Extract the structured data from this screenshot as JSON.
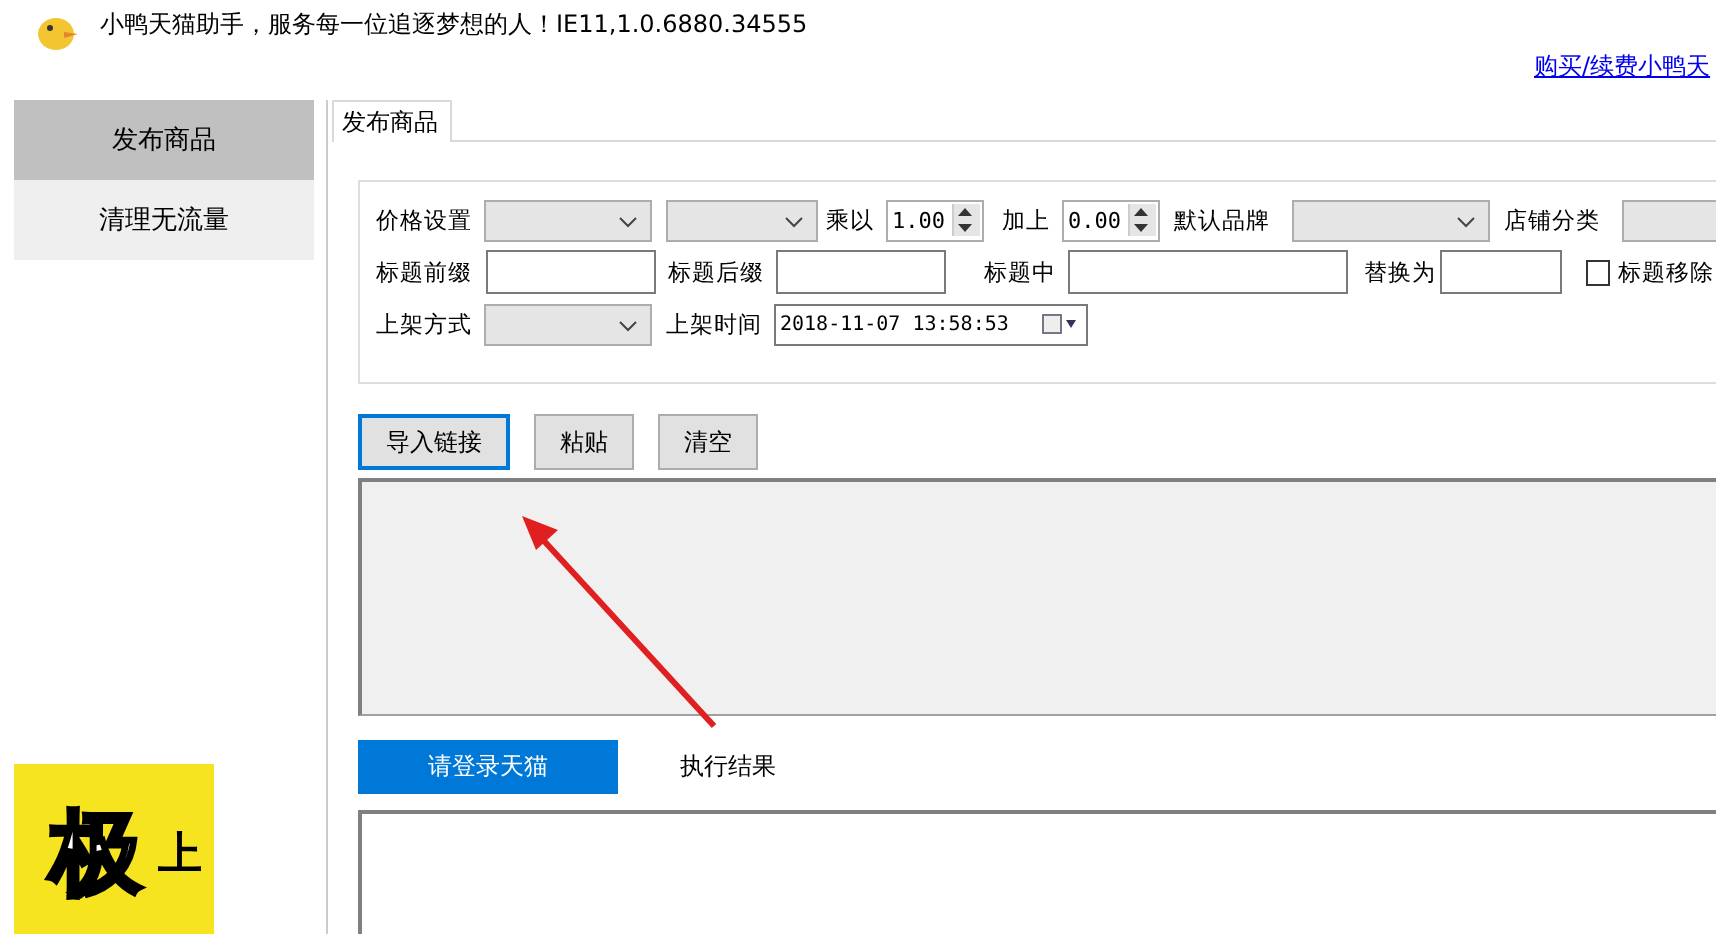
{
  "window": {
    "title": "小鸭天猫助手，服务每一位追逐梦想的人！IE11,1.0.6880.34555",
    "link": "购买/续费小鸭天"
  },
  "sidebar": {
    "items": [
      {
        "label": "发布商品",
        "selected": true
      },
      {
        "label": "清理无流量",
        "selected": false
      }
    ]
  },
  "tabs": [
    {
      "label": "发布商品",
      "selected": true
    }
  ],
  "form": {
    "lines": [
      {
        "fields": [
          {
            "kind": "label",
            "text": "价格设置"
          },
          {
            "kind": "select"
          },
          {
            "kind": "select"
          },
          {
            "kind": "label",
            "text": "乘以"
          },
          {
            "kind": "spin",
            "value": "1.00"
          },
          {
            "kind": "label",
            "text": "加上"
          },
          {
            "kind": "spin",
            "value": "0.00"
          },
          {
            "kind": "label",
            "text": "默认品牌"
          },
          {
            "kind": "select"
          },
          {
            "kind": "label",
            "text": "店铺分类"
          },
          {
            "kind": "select"
          }
        ]
      },
      {
        "fields": [
          {
            "kind": "label",
            "text": "标题前缀"
          },
          {
            "kind": "text"
          },
          {
            "kind": "label",
            "text": "标题后缀"
          },
          {
            "kind": "text"
          },
          {
            "kind": "label",
            "text": "标题中"
          },
          {
            "kind": "text"
          },
          {
            "kind": "label",
            "text": "替换为"
          },
          {
            "kind": "text"
          },
          {
            "kind": "checkbox",
            "text": "标题移除",
            "checked": false
          }
        ]
      },
      {
        "fields": [
          {
            "kind": "label",
            "text": "上架方式"
          },
          {
            "kind": "select"
          },
          {
            "kind": "label",
            "text": "上架时间"
          },
          {
            "kind": "datetime",
            "value": "2018-11-07 13:58:53"
          }
        ]
      }
    ]
  },
  "buttons": [
    {
      "label": "导入链接",
      "selected": true
    },
    {
      "label": "粘贴",
      "selected": false
    },
    {
      "label": "清空",
      "selected": false
    }
  ],
  "bottom_tabs": [
    {
      "label": "请登录天猫",
      "selected": true
    },
    {
      "label": "执行结果",
      "selected": false
    }
  ],
  "banner": {
    "big": "极",
    "small": "上"
  }
}
